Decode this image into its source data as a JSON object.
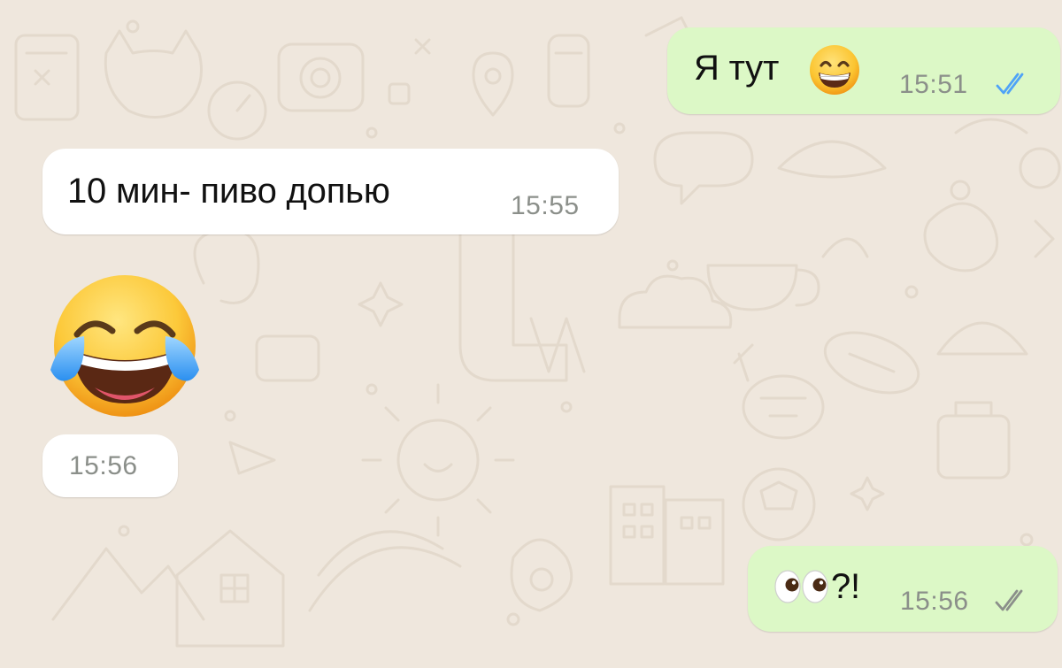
{
  "conversation": {
    "messages": [
      {
        "direction": "outgoing",
        "text": "Я тут",
        "emoji": "grinning-face-with-smiling-eyes",
        "time": "15:51",
        "status": "read",
        "tick_color": "#4fa3f7"
      },
      {
        "direction": "incoming",
        "text": "10 мин- пиво допью",
        "time": "15:55"
      },
      {
        "direction": "incoming",
        "emoji": "face-with-tears-of-joy",
        "time": "15:56"
      },
      {
        "direction": "outgoing",
        "emoji": "eyes",
        "text": "?!",
        "time": "15:56",
        "status": "delivered",
        "tick_color": "#8b8f8a"
      }
    ]
  },
  "theme": {
    "wallpaper_color": "#efe7dd",
    "outgoing_bubble_color": "#dcf8c6",
    "incoming_bubble_color": "#ffffff"
  }
}
